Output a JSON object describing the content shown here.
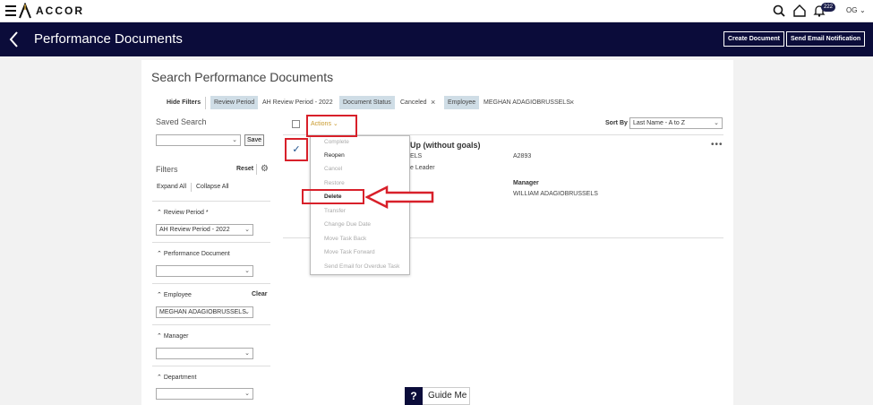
{
  "brand": {
    "name": "ACCOR"
  },
  "topbar": {
    "notifications_count": "222",
    "user_initials": "OG"
  },
  "header": {
    "title": "Performance Documents",
    "create_label": "Create Document",
    "send_email_label": "Send Email Notification"
  },
  "search": {
    "title": "Search Performance Documents",
    "hide_filters": "Hide Filters",
    "chips": [
      {
        "label": "Review Period",
        "value": "AH Review Period - 2022"
      },
      {
        "label": "Document Status",
        "value": "Canceled"
      },
      {
        "label": "Employee",
        "value": "MEGHAN ADAGIOBRUSSELS"
      }
    ]
  },
  "saved_search": {
    "title": "Saved Search",
    "save_label": "Save"
  },
  "filters": {
    "title": "Filters",
    "reset": "Reset",
    "expand_all": "Expand All",
    "collapse_all": "Collapse All",
    "clear": "Clear",
    "groups": [
      {
        "title": "Review Period *",
        "value": "AH Review Period - 2022"
      },
      {
        "title": "Performance Document",
        "value": ""
      },
      {
        "title": "Employee",
        "value": "MEGHAN ADAGIOBRUSSELS"
      },
      {
        "title": "Manager",
        "value": ""
      },
      {
        "title": "Department",
        "value": ""
      }
    ]
  },
  "results": {
    "actions_label": "Actions",
    "sort_by_label": "Sort By",
    "sort_value": "Last Name - A to Z",
    "doc": {
      "title_partial": "Up (without goals)",
      "line1": "ELS",
      "line2": "e Leader",
      "id": "A2893",
      "manager_label": "Manager",
      "manager_value": "WILLIAM ADAGIOBRUSSELS"
    }
  },
  "menu": {
    "items": [
      {
        "label": "Complete",
        "enabled": false
      },
      {
        "label": "Reopen",
        "enabled": true
      },
      {
        "label": "Cancel",
        "enabled": false
      },
      {
        "label": "Restore",
        "enabled": false
      },
      {
        "label": "Delete",
        "enabled": true
      },
      {
        "label": "Transfer",
        "enabled": false
      },
      {
        "label": "Change Due Date",
        "enabled": false
      },
      {
        "label": "Move Task Back",
        "enabled": false
      },
      {
        "label": "Move Task Forward",
        "enabled": false
      },
      {
        "label": "Send Email for Overdue Task",
        "enabled": false
      }
    ]
  },
  "guide": {
    "label": "Guide Me",
    "q": "?"
  },
  "colors": {
    "navy": "#0b0c3a",
    "annotation_red": "#d8202a",
    "accent_gold": "#c99a2e",
    "chip_bg": "#cfdde6"
  }
}
